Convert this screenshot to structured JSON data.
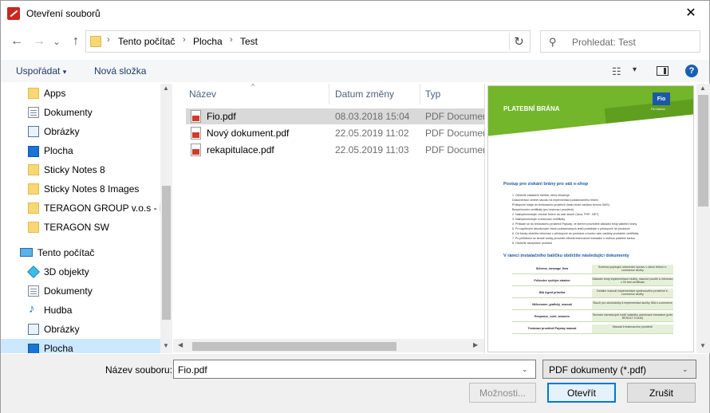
{
  "window": {
    "title": "Otevření souborů",
    "close_glyph": "✕"
  },
  "nav": {
    "back_glyph": "←",
    "forward_glyph": "→",
    "recent_glyph": "⌄",
    "up_glyph": "↑",
    "breadcrumbs": [
      "Tento počítač",
      "Plocha",
      "Test"
    ],
    "separator": "›",
    "refresh_glyph": "↻",
    "search_placeholder": "Prohledat: Test",
    "search_glyph": "⚲"
  },
  "toolbar": {
    "organize": "Uspořádat",
    "organize_caret": "▾",
    "new_folder": "Nová složka",
    "view_caret": "▾",
    "view_glyph": "☷",
    "help_glyph": "?"
  },
  "sidebar": {
    "items": [
      {
        "label": "Apps",
        "icon": "folder-icon"
      },
      {
        "label": "Dokumenty",
        "icon": "documents-icon"
      },
      {
        "label": "Obrázky",
        "icon": "pictures-icon"
      },
      {
        "label": "Plocha",
        "icon": "desktop-icon"
      },
      {
        "label": "Sticky Notes 8",
        "icon": "folder-icon"
      },
      {
        "label": "Sticky Notes 8 Images",
        "icon": "folder-icon"
      },
      {
        "label": "TERAGON GROUP v.o.s - Dc",
        "icon": "folder-icon"
      },
      {
        "label": "TERAGON SW",
        "icon": "folder-icon"
      },
      {
        "label": "Tento počítač",
        "icon": "computer-icon"
      },
      {
        "label": "3D objekty",
        "icon": "3d-objects-icon"
      },
      {
        "label": "Dokumenty",
        "icon": "documents-icon"
      },
      {
        "label": "Hudba",
        "icon": "music-icon"
      },
      {
        "label": "Obrázky",
        "icon": "pictures-icon"
      },
      {
        "label": "Plocha",
        "icon": "desktop-icon"
      }
    ],
    "selected": "Plocha"
  },
  "filelist": {
    "columns": [
      "Název",
      "Datum změny",
      "Typ"
    ],
    "sort_glyph": "^",
    "files": [
      {
        "name": "Fio.pdf",
        "date": "08.03.2018 15:04",
        "type": "PDF Documen",
        "selected": true
      },
      {
        "name": "Nový dokument.pdf",
        "date": "22.05.2019 11:02",
        "type": "PDF Documen",
        "selected": false
      },
      {
        "name": "rekapitulace.pdf",
        "date": "22.05.2019 11:03",
        "type": "PDF Documen",
        "selected": false
      }
    ],
    "scroll_left": "◀",
    "scroll_right": "▶",
    "scroll_up": "▲",
    "scroll_down": "▼"
  },
  "preview": {
    "title": "PLATEBNÍ BRÁNA",
    "logo": "Fio",
    "logo_sub": "Fio banka",
    "heading1": "Postup pro získání brány pro váš e-shop",
    "steps": [
      "1.    Obdržíte instalační balíček, který obsahuje:",
      "              Dokumentaci včetně návodu na implementaci požadovaného řešení",
      "              Přístupové údaje do testovacího prostředí (heslo bude zasláno formou SMS)",
      "              Bezpečnostní certifikáty (pro testovací prostředí)",
      "2.    Naimplementujte vhodné řešení na vaší straně (Java, PHP, .NET)",
      "3.    Naimplementujte si testovací certifikáty",
      "4.    Příklade se do testovacího prostředí Payway, ve kterém provedete základní testy platební brány",
      "5.    Po úspěšném absolvování všech požadovaných testů požádejte o přístupové do produkce",
      "6.    Od banky obdržíte informaci o přístupové do produkce a budou vám zaslány produkční certifikáty",
      "7.    Po přihlášení se straně banky provedte několik testovacích transakcí s reálnou platební kartou",
      "8.    Obdržíte akceptační protokol"
    ],
    "heading2": "V rámci instalačního balíčku obdržíte následující dokumenty",
    "table": [
      {
        "name": "Schema_message_flow",
        "desc": "Schéma popisující sekvenční úpravu v rámci řešení e-commerce služby"
      },
      {
        "name": "Průvodce rychlým startem",
        "desc": "Základní testy implementace služby, stavové použití a informací v 03 test certifikátu"
      },
      {
        "name": "IMA Agent příručka",
        "desc": "Detailní manuál implementace systémového prostředí e-commerce služby"
      },
      {
        "name": "IMAecomm_grafický_manuál",
        "desc": "Slouží pro obchodníky k implementaci služby IMA e-commerce"
      },
      {
        "name": "Response_code_answers",
        "desc": "Seznam návratových kódů výsledku autorizace transakce (pole RESULT CODE)"
      },
      {
        "name": "Testovací prostředí Payway manual",
        "desc": "Manuál k testovacímu prostředí"
      }
    ]
  },
  "footer": {
    "filename_label": "Název souboru:",
    "filename_value": "Fio.pdf",
    "filetype_value": "PDF dokumenty (*.pdf)",
    "dropdown_caret": "⌄",
    "options_button": "Možnosti...",
    "open_button": "Otevřít",
    "cancel_button": "Zrušit"
  }
}
